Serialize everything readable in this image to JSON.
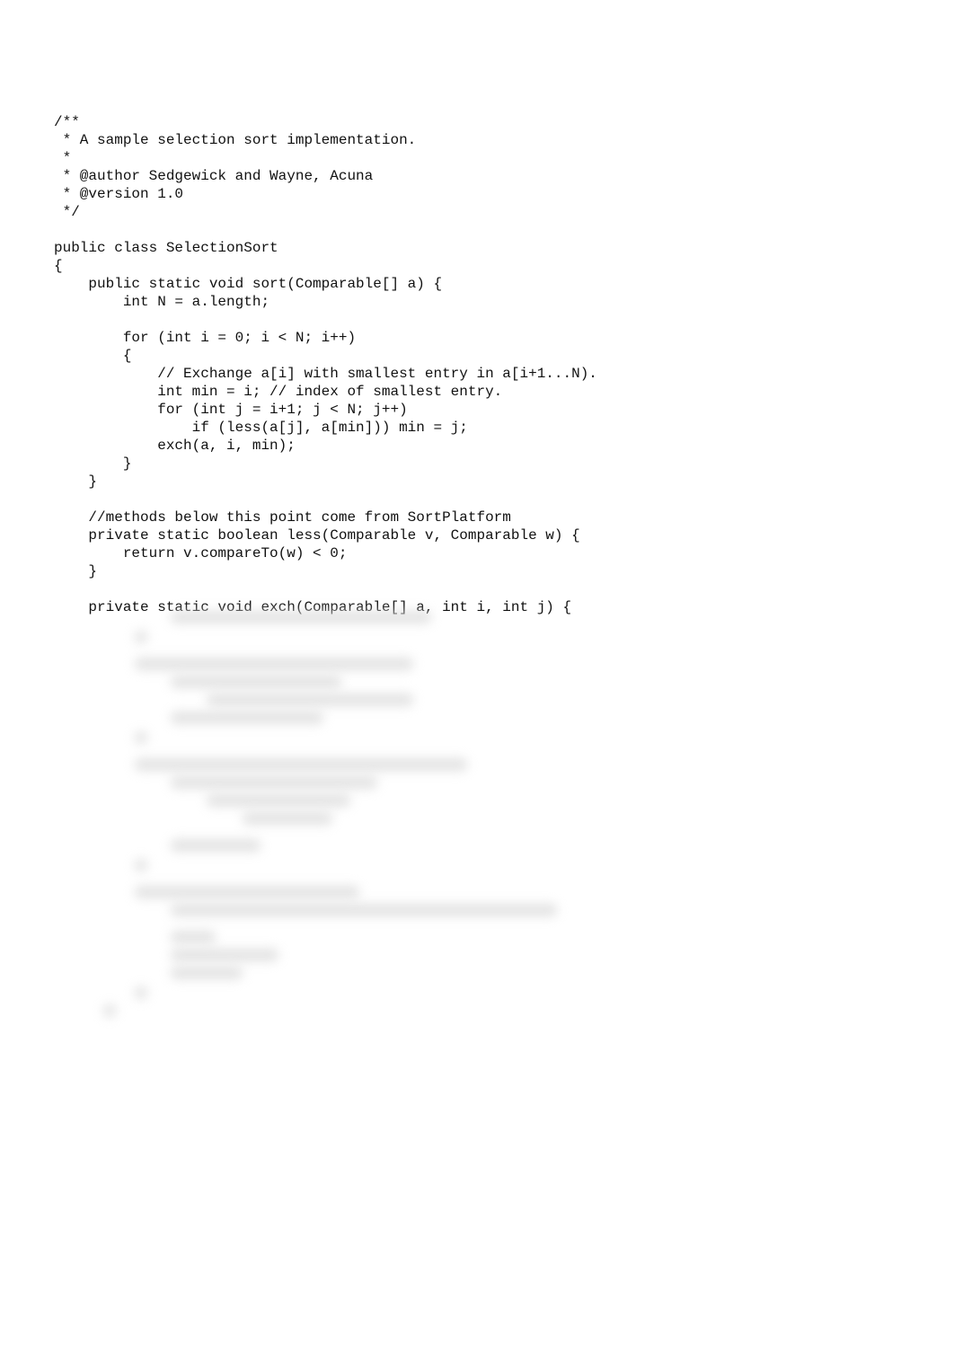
{
  "code_lines": [
    "/**",
    " * A sample selection sort implementation.",
    " *",
    " * @author Sedgewick and Wayne, Acuna",
    " * @version 1.0",
    " */",
    "",
    "public class SelectionSort",
    "{",
    "    public static void sort(Comparable[] a) {",
    "        int N = a.length;",
    "",
    "        for (int i = 0; i < N; i++)",
    "        {",
    "            // Exchange a[i] with smallest entry in a[i+1...N).",
    "            int min = i; // index of smallest entry.",
    "            for (int j = i+1; j < N; j++)",
    "                if (less(a[j], a[min])) min = j;",
    "            exch(a, i, min);",
    "        }",
    "    }",
    "",
    "    //methods below this point come from SortPlatform",
    "    private static boolean less(Comparable v, Comparable w) {",
    "        return v.compareTo(w) < 0;",
    "    }",
    "",
    "    private static void exch(Comparable[] a, int i, int j) {"
  ]
}
